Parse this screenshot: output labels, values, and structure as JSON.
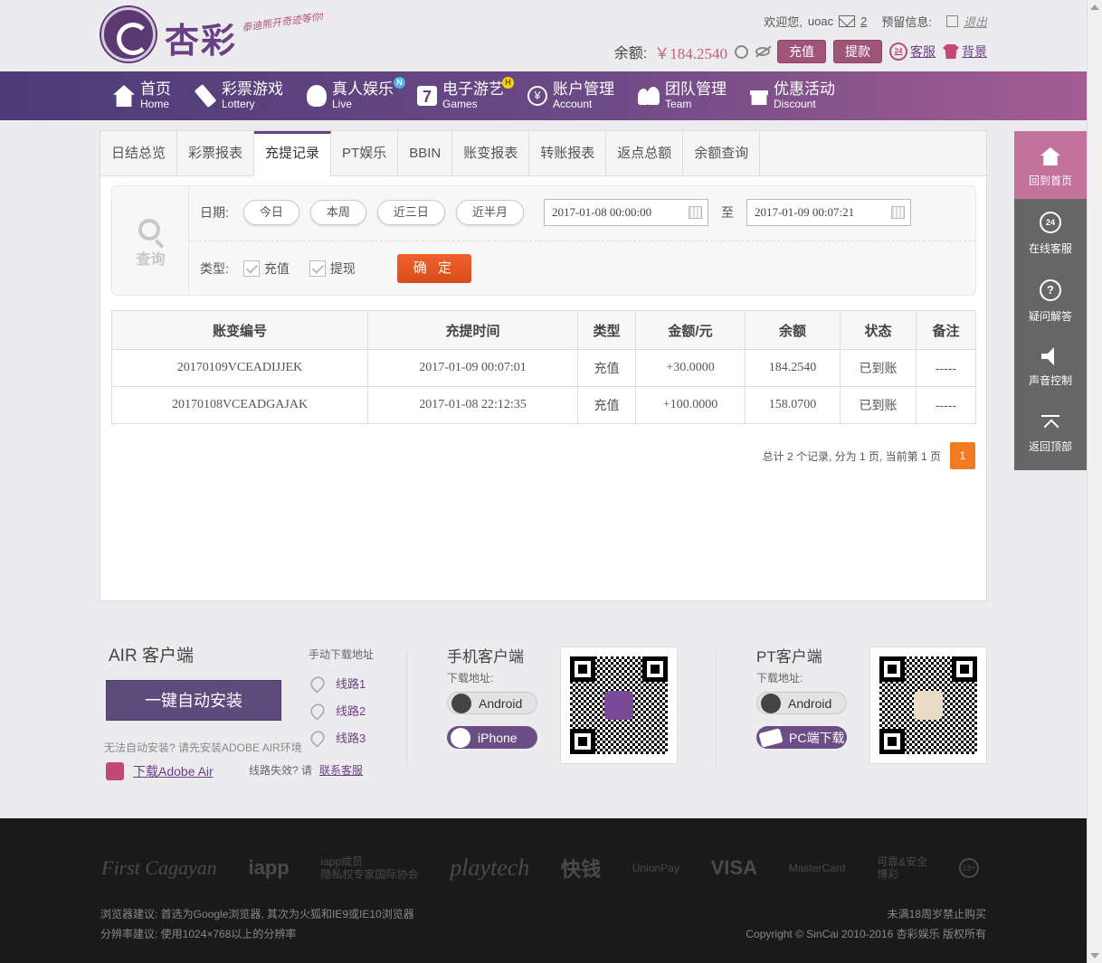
{
  "brand": {
    "logo_text": "杏彩",
    "slogan": "泰迪熊开奇迹等你!"
  },
  "header": {
    "welcome_label": "欢迎您,",
    "username": "uoac",
    "message_count": "2",
    "reserved_info_label": "预留信息:",
    "logout_label": "退出",
    "balance_label": "余额:",
    "balance_value": "￥184.2540",
    "deposit_label": "充值",
    "withdraw_label": "提款",
    "service_label": "客服",
    "service_icon_text": "24",
    "background_label": "背景"
  },
  "nav": [
    {
      "cn": "首页",
      "en": "Home",
      "icon": "home-icon"
    },
    {
      "cn": "彩票游戏",
      "en": "Lottery",
      "icon": "ticket-icon"
    },
    {
      "cn": "真人娱乐",
      "en": "Live",
      "icon": "dealer-icon",
      "badge": "N"
    },
    {
      "cn": "电子游艺",
      "en": "Games",
      "icon": "seven-icon",
      "icon_text": "7",
      "badge": "H"
    },
    {
      "cn": "账户管理",
      "en": "Account",
      "icon": "yen-icon",
      "icon_text": "¥"
    },
    {
      "cn": "团队管理",
      "en": "Team",
      "icon": "team-icon"
    },
    {
      "cn": "优惠活动",
      "en": "Discount",
      "icon": "gift-icon"
    }
  ],
  "tabs": [
    "日结总览",
    "彩票报表",
    "充提记录",
    "PT娱乐",
    "BBIN",
    "账变报表",
    "转账报表",
    "返点总额",
    "余额查询"
  ],
  "active_tab": 2,
  "query": {
    "icon_label": "查询",
    "date_label": "日期:",
    "quick_dates": [
      "今日",
      "本周",
      "近三日",
      "近半月"
    ],
    "start_datetime": "2017-01-08 00:00:00",
    "to_label": "至",
    "end_datetime": "2017-01-09 00:07:21",
    "type_label": "类型:",
    "types": [
      "充值",
      "提现"
    ],
    "confirm_label": "确 定"
  },
  "table": {
    "headers": [
      "账变编号",
      "充提时间",
      "类型",
      "金额/元",
      "余额",
      "状态",
      "备注"
    ],
    "rows": [
      [
        "20170109VCEADIJJEK",
        "2017-01-09 00:07:01",
        "充值",
        "+30.0000",
        "184.2540",
        "已到账",
        "-----"
      ],
      [
        "20170108VCEADGAJAK",
        "2017-01-08 22:12:35",
        "充值",
        "+100.0000",
        "158.0700",
        "已到账",
        "-----"
      ]
    ]
  },
  "pagination": {
    "summary": "总计 2 个记录, 分为 1 页, 当前第 1 页",
    "current_page": "1"
  },
  "right_sidebar": [
    {
      "label": "回到首页",
      "icon": "home-icon"
    },
    {
      "label": "在线客服",
      "icon": "support-24-icon",
      "icon_text": "24"
    },
    {
      "label": "疑问解答",
      "icon": "question-icon",
      "icon_text": "?"
    },
    {
      "label": "声音控制",
      "icon": "speaker-icon"
    },
    {
      "label": "返回顶部",
      "icon": "back-to-top-icon"
    }
  ],
  "downloads": {
    "air_title": "AIR 客户端",
    "air_button": "一键自动安装",
    "air_note": "无法自动安装? 请先安装ADOBE AIR环境",
    "air_link": "下载Adobe Air",
    "manual_title": "手动下载地址",
    "routes": [
      "线路1",
      "线路2",
      "线路3"
    ],
    "route_fail": "线路失效? 请",
    "contact_service": "联系客服",
    "mobile_title": "手机客户端",
    "mobile_sub": "下载地址:",
    "mobile_android": "Android",
    "mobile_iphone": "iPhone",
    "pt_title": "PT客户端",
    "pt_sub": "下载地址:",
    "pt_android": "Android",
    "pt_pc": "PC端下载"
  },
  "footer": {
    "partners": [
      "First Cagayan",
      "iapp",
      "iapp成员",
      "隐私权专家国际协会",
      "playtech",
      "快钱",
      "UnionPay",
      "VISA",
      "MasterCard",
      "可靠&安全",
      "博彩",
      "18+"
    ],
    "browser_note": "浏览器建议: 首选为Google浏览器, 其次为火狐和IE9或IE10浏览器",
    "resolution_note": "分辨率建议: 使用1024×768以上的分辨率",
    "age_note": "未满18周岁禁止购买",
    "copyright": "Copyright © SinCai 2010-2016 杏彩娱乐 版权所有"
  },
  "colors": {
    "brand_purple": "#6b3f86",
    "button_mauve": "#a05578",
    "confirm_orange": "#e4561f",
    "amount_red": "#d7282f",
    "status_green": "#2ca11a"
  }
}
